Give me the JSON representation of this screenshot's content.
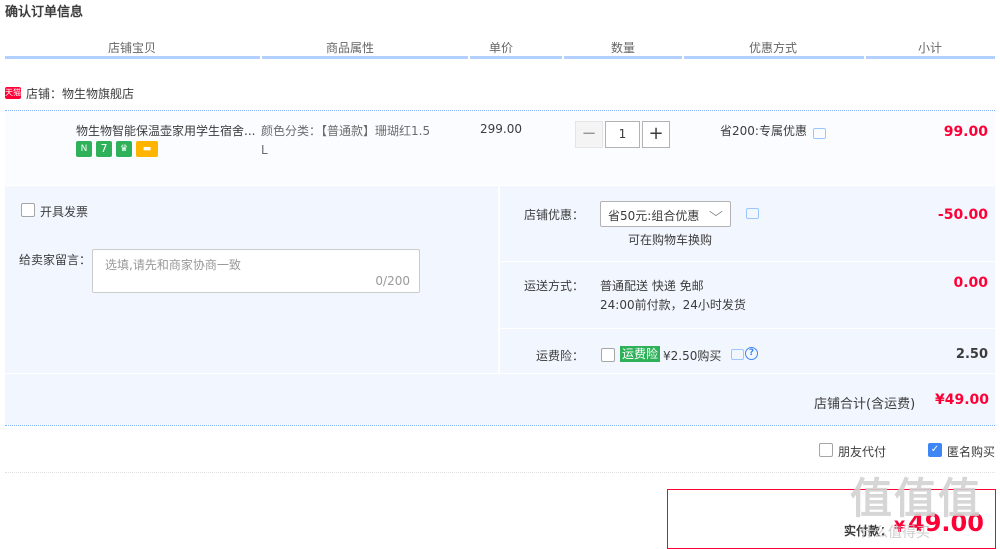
{
  "page_title": "确认订单信息",
  "table_headers": [
    "店铺宝贝",
    "商品属性",
    "单价",
    "数量",
    "优惠方式",
    "小计"
  ],
  "store": {
    "badge": "天猫",
    "label": "店铺：物生物旗舰店"
  },
  "item": {
    "name": "物生物智能保温壶家用学生宿舍...",
    "service_icons": [
      "new-icon",
      "seven-day-icon",
      "trophy-icon",
      "card-icon"
    ],
    "attr_line1": "颜色分类：【普通款】珊瑚红1.5",
    "attr_line2": "L",
    "price": "299.00",
    "qty_minus": "−",
    "quantity": "1",
    "qty_plus": "+",
    "discount": "省200:专属优惠",
    "subtotal": "99.00"
  },
  "invoice_label": "开具发票",
  "message": {
    "label": "给卖家留言：",
    "placeholder": "选填,请先和商家协商一致",
    "counter": "0/200"
  },
  "store_discount": {
    "label": "店铺优惠：",
    "selected": "省50元:组合优惠",
    "hint": "可在购物车换购",
    "amount": "-50.00"
  },
  "shipping": {
    "label": "运送方式：",
    "line1": "普通配送 快递 免邮",
    "line2": "24:00前付款，24小时发货",
    "amount": "0.00"
  },
  "insurance": {
    "label": "运费险：",
    "tag": "运费险",
    "text": "¥2.50购买",
    "amount": "2.50"
  },
  "store_total": {
    "label": "店铺合计(含运费)",
    "amount": "¥49.00"
  },
  "options": {
    "friend_pay": "朋友代付",
    "anonymous": "匿名购买"
  },
  "pay": {
    "label": "实付款：",
    "currency": "¥",
    "amount": "49.00"
  },
  "watermark": {
    "main": "值值值",
    "sub": "什么值得买"
  },
  "colors": {
    "accent": "#ff0036",
    "line": "#b2d1ff",
    "panel": "#f2f7ff",
    "check": "#3e86f5",
    "tag": "#2fb15a"
  }
}
